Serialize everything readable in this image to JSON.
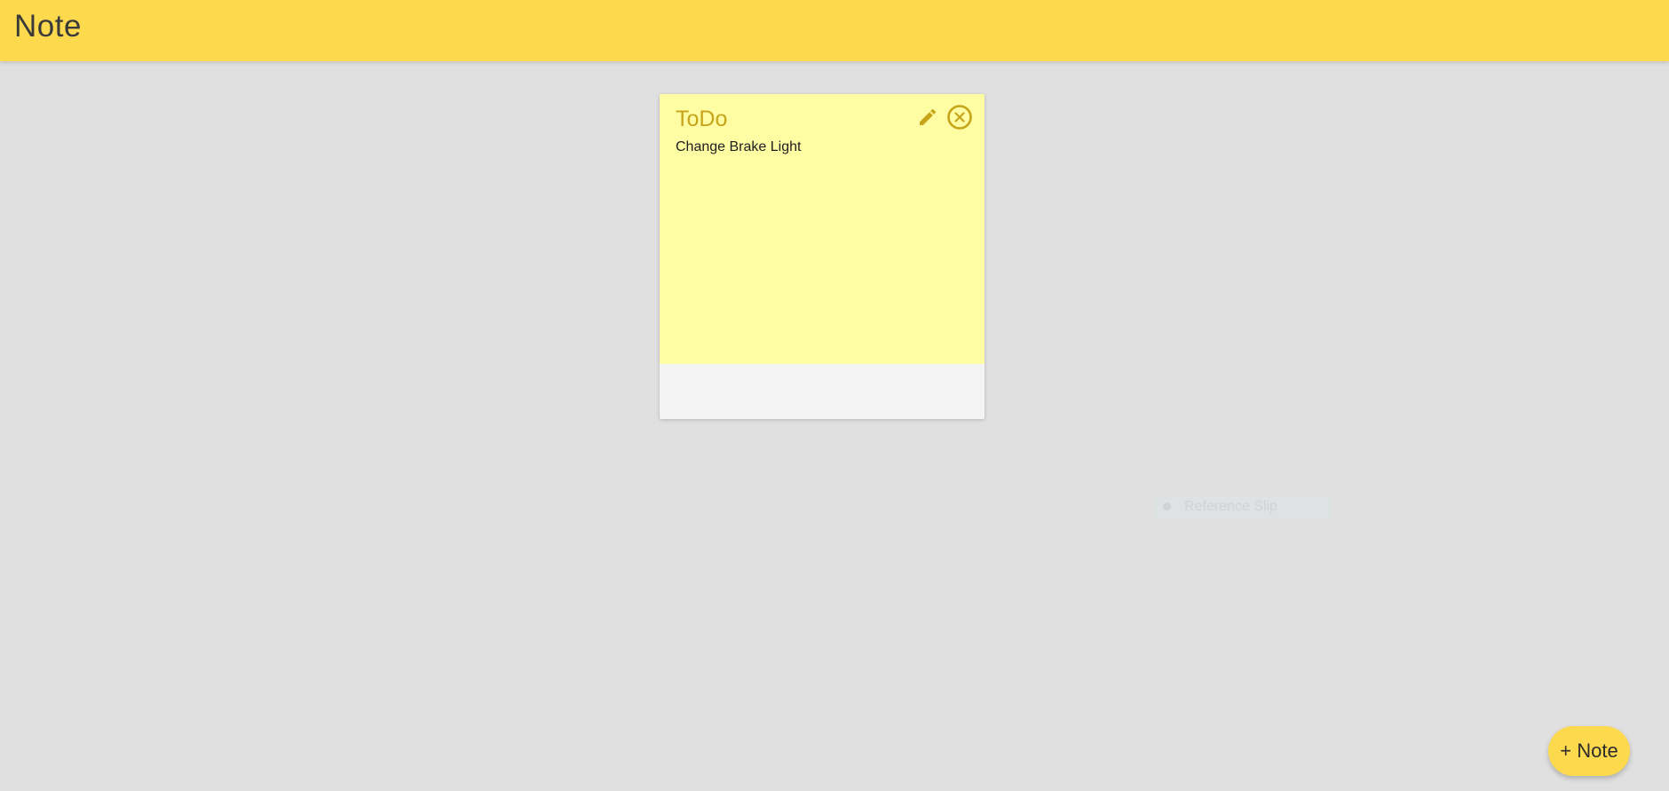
{
  "app": {
    "title": "Note",
    "accent_color": "#fdd94e"
  },
  "notes": [
    {
      "title": "ToDo",
      "text": "Change Brake Light",
      "color": "#fffda3",
      "actions": [
        "edit-icon",
        "close-circle-icon"
      ]
    }
  ],
  "ghost_item": {
    "label": "Reference Slip"
  },
  "fab": {
    "label": "+ Note"
  }
}
